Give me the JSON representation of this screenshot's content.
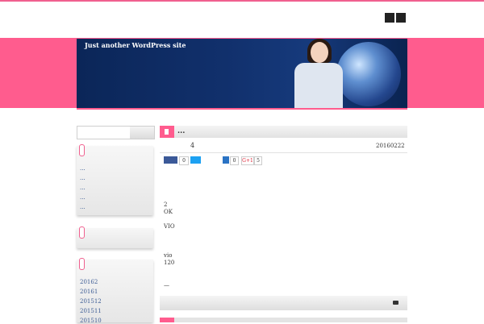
{
  "header": {
    "tagline": "Just another WordPress site",
    "icons": [
      "sitemap-icon",
      "rss-icon"
    ]
  },
  "colors": {
    "accent": "#ff5c8e",
    "header_bg": "#11306c",
    "link": "#3b5b94"
  },
  "sidebar": {
    "search": {
      "value": "",
      "placeholder": ""
    },
    "widget1_items": [
      "...",
      "...",
      "...",
      "...",
      "..."
    ],
    "archive_items": [
      "20162",
      "20161",
      "201512",
      "201511",
      "201510"
    ]
  },
  "post": {
    "title": "...",
    "heading": "4",
    "date": "20160222",
    "share": {
      "facebook_count": "0",
      "hatena_count": "0",
      "google_label": "G+1",
      "google_count": "5"
    },
    "lines": [
      "2",
      "OK",
      "VIO",
      "vio",
      "120",
      "—"
    ]
  }
}
